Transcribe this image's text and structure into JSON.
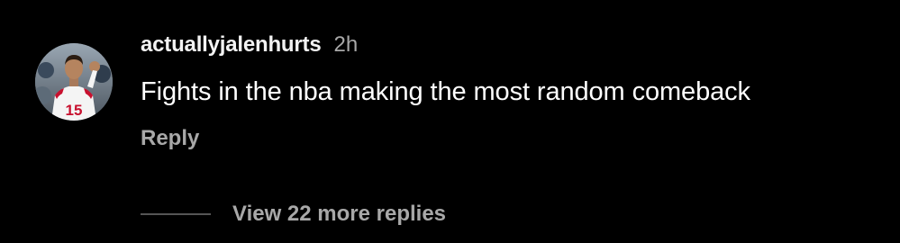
{
  "comment": {
    "username": "actuallyjalenhurts",
    "timestamp": "2h",
    "text": "Fights in the nba making the most random comeback",
    "reply_label": "Reply",
    "view_replies_label": "View 22 more replies",
    "avatar_icon": "profile-photo-avatar",
    "avatar_jersey_number": "15"
  },
  "colors": {
    "background": "#000000",
    "primary_text": "#ffffff",
    "secondary_text": "#a8a8a8",
    "jersey_red": "#c8102e"
  }
}
